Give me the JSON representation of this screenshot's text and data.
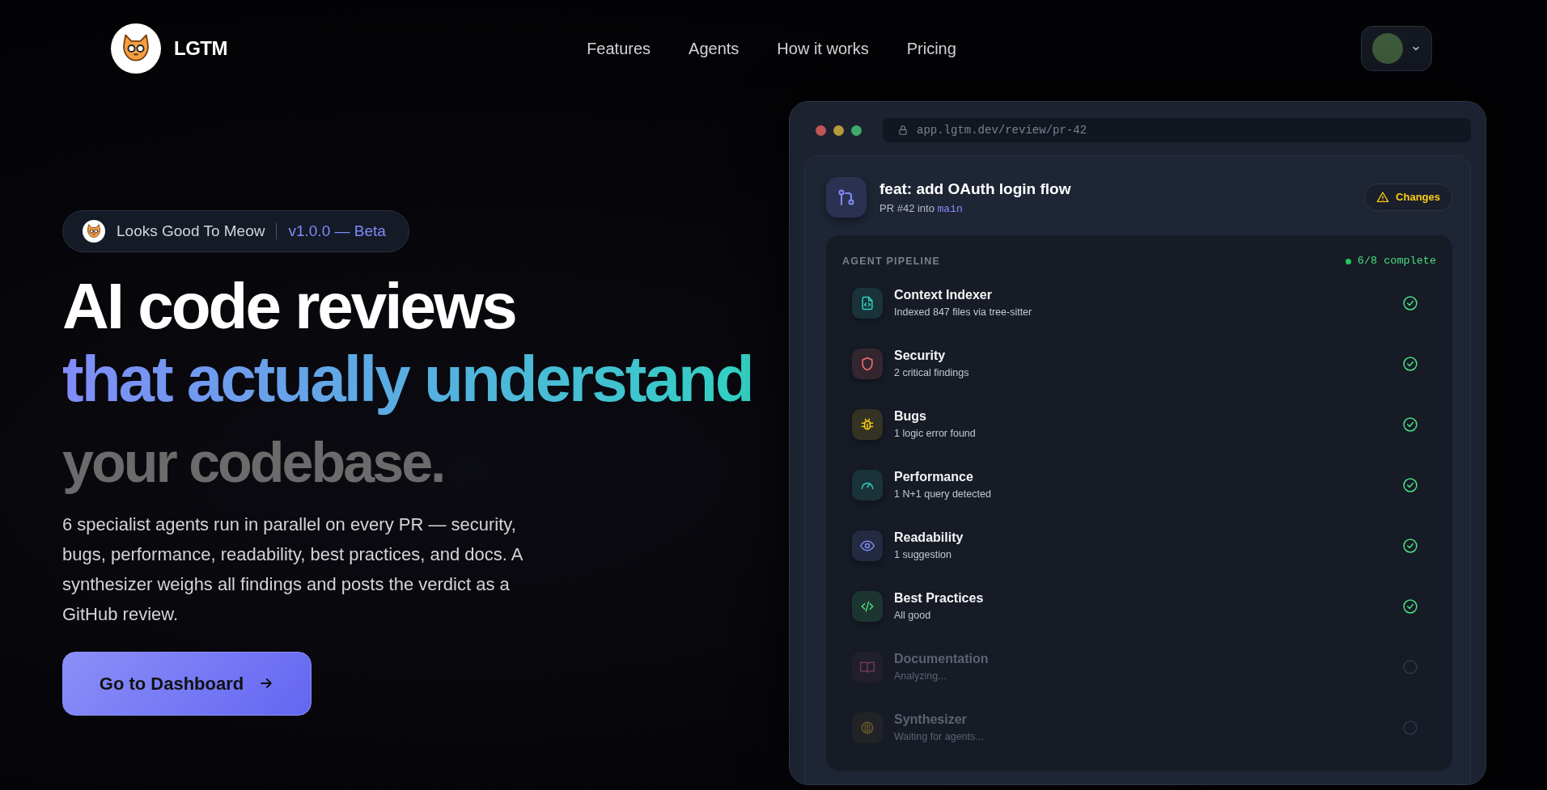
{
  "brand": {
    "name": "LGTM"
  },
  "nav": {
    "links": [
      "Features",
      "Agents",
      "How it works",
      "Pricing"
    ]
  },
  "hero": {
    "badge": {
      "label": "Looks Good To Meow",
      "version": "v1.0.0 — Beta"
    },
    "headline": [
      {
        "text": "AI code reviews",
        "kind": "plain"
      },
      {
        "text": "that actually understand",
        "kind": "gradient"
      },
      {
        "text": "your codebase.",
        "kind": "muted"
      }
    ],
    "description": "6 specialist agents run in parallel on every PR — security, bugs, performance, readability, best practices, and docs. A synthesizer weighs all findings and posts the verdict as a GitHub review.",
    "cta": "Go to Dashboard"
  },
  "preview": {
    "url": "app.lgtm.dev/review/pr-42",
    "pr": {
      "title": "feat: add OAuth login flow",
      "subtitle": "PR #42 into",
      "branch": "main",
      "verdict": "Changes"
    },
    "pipeline": {
      "heading": "AGENT PIPELINE",
      "progress": "6/8 complete",
      "agents": [
        {
          "name": "Context Indexer",
          "detail": "Indexed 847 files via tree-sitter",
          "kind": "file",
          "color": "#2dd4bf",
          "done": true
        },
        {
          "name": "Security",
          "detail": "2 critical findings",
          "kind": "shield",
          "color": "#f87171",
          "done": true
        },
        {
          "name": "Bugs",
          "detail": "1 logic error found",
          "kind": "bug",
          "color": "#facc15",
          "done": true
        },
        {
          "name": "Performance",
          "detail": "1 N+1 query detected",
          "kind": "gauge",
          "color": "#2dd4bf",
          "done": true
        },
        {
          "name": "Readability",
          "detail": "1 suggestion",
          "kind": "eye",
          "color": "#818cf8",
          "done": true
        },
        {
          "name": "Best Practices",
          "detail": "All good",
          "kind": "code",
          "color": "#4ade80",
          "done": true
        },
        {
          "name": "Documentation",
          "detail": "Analyzing...",
          "kind": "book",
          "color": "#6b3a55",
          "done": false
        },
        {
          "name": "Synthesizer",
          "detail": "Waiting for agents...",
          "kind": "brain",
          "color": "#6b5a2a",
          "done": false
        }
      ]
    }
  }
}
